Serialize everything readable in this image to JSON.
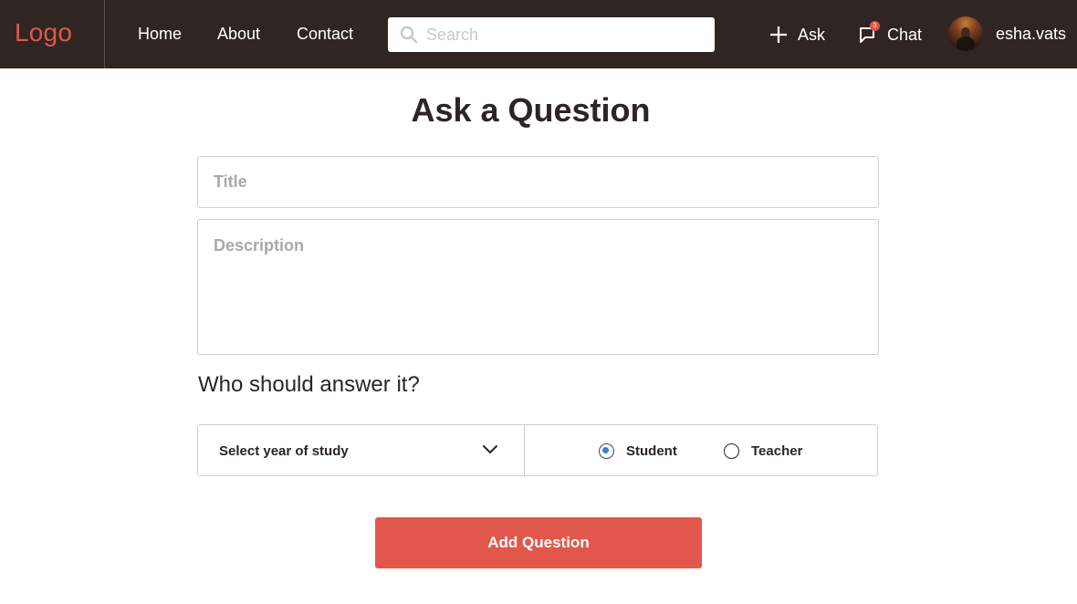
{
  "navbar": {
    "logo": "Logo",
    "links": [
      "Home",
      "About",
      "Contact"
    ],
    "search_placeholder": "Search",
    "ask_label": "Ask",
    "chat_label": "Chat",
    "chat_badge": "3",
    "username": "esha.vats"
  },
  "form": {
    "heading": "Ask a Question",
    "title_placeholder": "Title",
    "description_placeholder": "Description",
    "audience_question": "Who should answer it?",
    "year_select_label": "Select year of study",
    "role_options": [
      {
        "label": "Student",
        "selected": true
      },
      {
        "label": "Teacher",
        "selected": false
      }
    ],
    "submit_label": "Add Question"
  },
  "colors": {
    "navbar_bg": "#2f2624",
    "accent": "#e2574c",
    "radio_selected": "#3d82d6"
  }
}
